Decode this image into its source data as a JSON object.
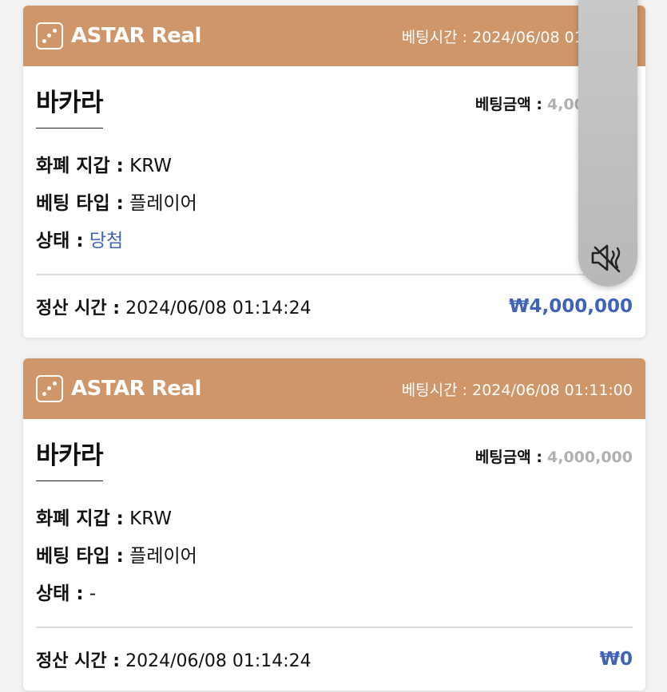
{
  "cards": [
    {
      "brand": "ASTAR Real",
      "bet_time": "베팅시간 : 2024/06/08 01:11:00",
      "game": "바카라",
      "amount_label": "베팅금액 :",
      "amount_value": "4,000,000",
      "rows": [
        {
          "label": "화폐 지갑 :",
          "value": "KRW"
        },
        {
          "label": "베팅 타입 :",
          "value": "플레이어"
        },
        {
          "label": "상태 :",
          "value": "당첨"
        }
      ],
      "settle_label": "정산 시간 :",
      "settle_time": "2024/06/08 01:14:24",
      "payout": "₩4,000,000"
    },
    {
      "brand": "ASTAR Real",
      "bet_time": "베팅시간 : 2024/06/08 01:11:00",
      "game": "바카라",
      "amount_label": "베팅금액 :",
      "amount_value": "4,000,000",
      "rows": [
        {
          "label": "화폐 지갑 :",
          "value": "KRW"
        },
        {
          "label": "베팅 타입 :",
          "value": "플레이어"
        },
        {
          "label": "상태 :",
          "value": "-"
        }
      ],
      "settle_label": "정산 시간 :",
      "settle_time": "2024/06/08 01:14:24",
      "payout": "₩0"
    }
  ],
  "overlay": {
    "icon": "speaker-mute-icon"
  },
  "colors": {
    "header": "#cf9669",
    "accent": "#3f63b8",
    "muted": "#b0b0b0"
  }
}
